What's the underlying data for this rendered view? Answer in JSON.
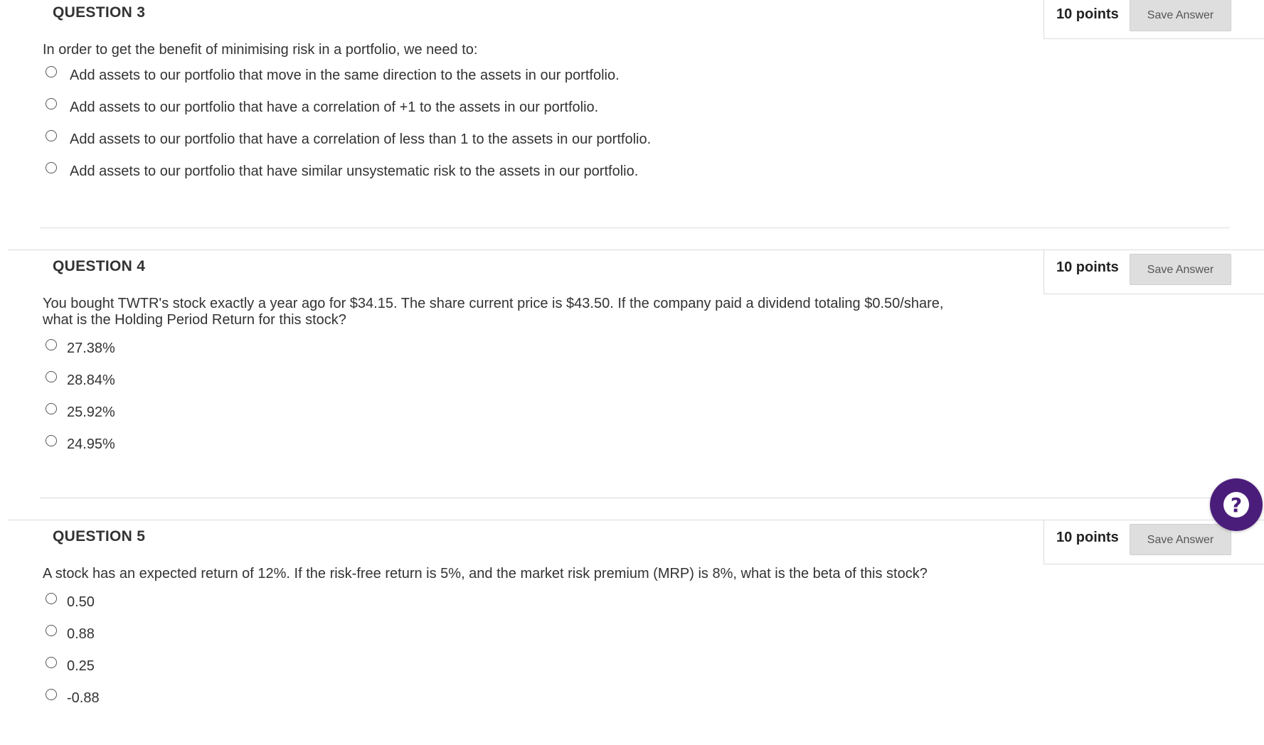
{
  "questions": [
    {
      "title": "QUESTION 3",
      "points": "10 points",
      "save_label": "Save Answer",
      "text": "In order to get the benefit of minimising risk in a portfolio, we need to:",
      "choices": [
        "Add assets to our portfolio that move in the same direction to the assets in our portfolio.",
        "Add assets to our portfolio that have a correlation of +1 to the assets in our portfolio.",
        "Add assets to our portfolio that have a correlation of less than 1 to the assets in our portfolio.",
        "Add assets to our portfolio that have similar unsystematic risk to the assets in our portfolio."
      ]
    },
    {
      "title": "QUESTION 4",
      "points": "10 points",
      "save_label": "Save Answer",
      "text_line1": "You bought TWTR's stock exactly a year ago for $34.15. The share current price is $43.50. If the company paid a dividend totaling $0.50/share,",
      "text_line2": "what is the Holding Period Return for this stock?",
      "choices": [
        "27.38%",
        "28.84%",
        "25.92%",
        "24.95%"
      ]
    },
    {
      "title": "QUESTION 5",
      "points": "10 points",
      "save_label": "Save Answer",
      "text": "A stock has an expected return of 12%. If the risk-free return is 5%, and the market risk premium (MRP) is 8%, what is the beta of this stock?",
      "choices": [
        "0.50",
        "0.88",
        "0.25",
        "-0.88"
      ]
    }
  ],
  "help": {
    "icon": "question-mark-icon",
    "glyph": "?",
    "color": "#4b1d7a"
  },
  "colors": {
    "text": "#333333",
    "button_bg": "#dedede",
    "rule": "#dcdcdc"
  }
}
